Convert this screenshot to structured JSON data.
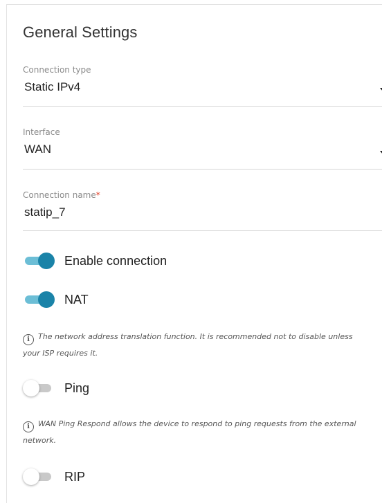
{
  "section": {
    "title": "General Settings"
  },
  "connection_type": {
    "label": "Connection type",
    "value": "Static IPv4"
  },
  "interface": {
    "label": "Interface",
    "value": "WAN"
  },
  "connection_name": {
    "label": "Connection name",
    "required_mark": "*",
    "value": "statip_7"
  },
  "toggles": {
    "enable_connection": {
      "label": "Enable connection",
      "state": "on"
    },
    "nat": {
      "label": "NAT",
      "state": "on"
    },
    "ping": {
      "label": "Ping",
      "state": "off"
    },
    "rip": {
      "label": "RIP",
      "state": "off"
    }
  },
  "hints": {
    "nat": "The network address translation function. It is recommended not to disable unless your ISP requires it.",
    "ping": "WAN Ping Respond allows the device to respond to ping requests from the external network."
  },
  "colors": {
    "toggle_on_knob": "#1a83a8",
    "toggle_on_track": "#6cbed6",
    "toggle_off_track": "#c9c9c9",
    "required_asterisk": "#e0341b"
  },
  "icons": {
    "dropdown": "caret-down-icon",
    "info": "info-circle-icon"
  }
}
